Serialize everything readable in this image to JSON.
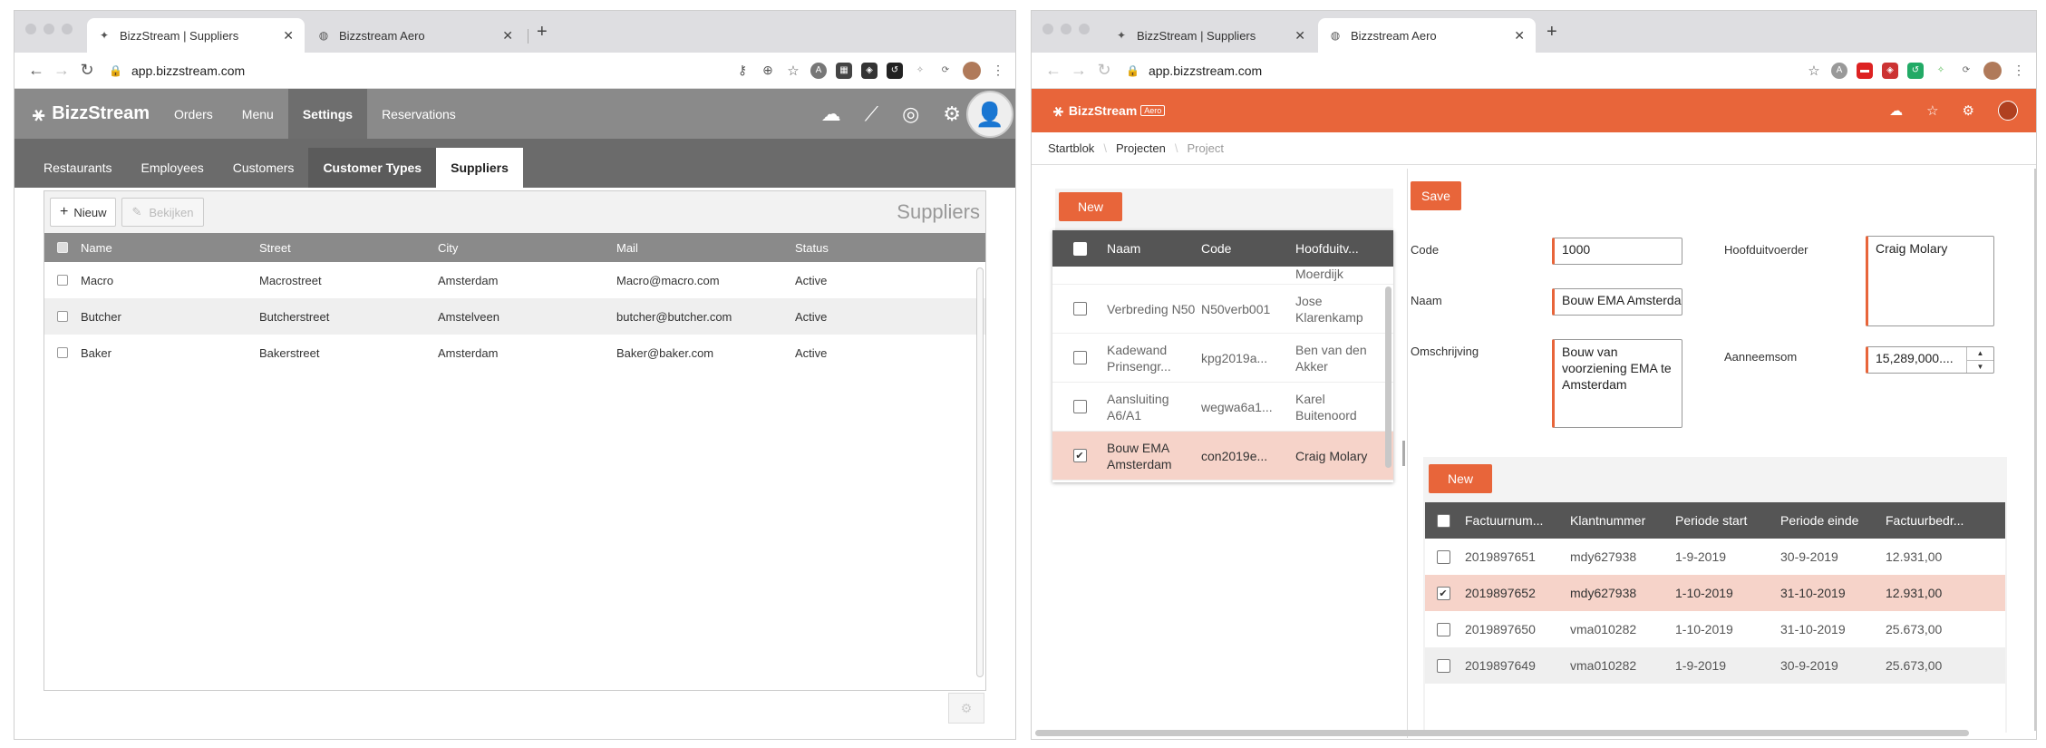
{
  "w1": {
    "browser": {
      "tabs": [
        {
          "title": "BizzStream | Suppliers"
        },
        {
          "title": "Bizzstream Aero"
        }
      ],
      "url": "app.bizzstream.com"
    },
    "app": {
      "logo": "BizzStream",
      "nav": [
        "Orders",
        "Menu",
        "Settings",
        "Reservations"
      ],
      "subtabs": [
        "Restaurants",
        "Employees",
        "Customers",
        "Customer Types",
        "Suppliers"
      ],
      "toolbar": {
        "new_label": "Nieuw",
        "view_label": "Bekijken"
      },
      "panel_title": "Suppliers",
      "columns": [
        "Name",
        "Street",
        "City",
        "Mail",
        "Status"
      ],
      "rows": [
        [
          "Macro",
          "Macrostreet",
          "Amsterdam",
          "Macro@macro.com",
          "Active"
        ],
        [
          "Butcher",
          "Butcherstreet",
          "Amstelveen",
          "butcher@butcher.com",
          "Active"
        ],
        [
          "Baker",
          "Bakerstreet",
          "Amsterdam",
          "Baker@baker.com",
          "Active"
        ]
      ]
    }
  },
  "w2": {
    "browser": {
      "tabs": [
        {
          "title": "BizzStream | Suppliers"
        },
        {
          "title": "Bizzstream Aero"
        }
      ],
      "url": "app.bizzstream.com"
    },
    "app": {
      "logo": "BizzStream",
      "logo_badge": "Aero",
      "breadcrumb": [
        "Startblok",
        "Projecten",
        "Project"
      ],
      "left": {
        "new_label": "New",
        "columns": [
          "Naam",
          "Code",
          "Hoofduitv..."
        ],
        "partial_top": "Moerdijk",
        "rows": [
          {
            "naam": "Verbreding N50",
            "code": "N50verb001",
            "hoofd": "Jose Klarenkamp",
            "checked": false
          },
          {
            "naam": "Kadewand Prinsengr...",
            "code": "kpg2019a...",
            "hoofd": "Ben van den Akker",
            "checked": false
          },
          {
            "naam": "Aansluiting A6/A1",
            "code": "wegwa6a1...",
            "hoofd": "Karel Buitenoord",
            "checked": false
          },
          {
            "naam": "Bouw EMA Amsterdam",
            "code": "con2019e...",
            "hoofd": "Craig Molary",
            "checked": true
          }
        ]
      },
      "form": {
        "save_label": "Save",
        "code_label": "Code",
        "code_value": "1000",
        "naam_label": "Naam",
        "naam_value": "Bouw EMA Amsterdam",
        "omschrijving_label": "Omschrijving",
        "omschrijving_value": "Bouw van voorziening EMA te Amsterdam",
        "hoofd_label": "Hoofduitvoerder",
        "hoofd_value": "Craig Molary",
        "aanneemsom_label": "Aanneemsom",
        "aanneemsom_value": "15,289,000...."
      },
      "invoices": {
        "new_label": "New",
        "columns": [
          "Factuurnum...",
          "Klantnummer",
          "Periode start",
          "Periode einde",
          "Factuurbedr..."
        ],
        "rows": [
          {
            "cells": [
              "2019897651",
              "mdy627938",
              "1-9-2019",
              "30-9-2019",
              "12.931,00"
            ],
            "checked": false
          },
          {
            "cells": [
              "2019897652",
              "mdy627938",
              "1-10-2019",
              "31-10-2019",
              "12.931,00"
            ],
            "checked": true
          },
          {
            "cells": [
              "2019897650",
              "vma010282",
              "1-10-2019",
              "31-10-2019",
              "25.673,00"
            ],
            "checked": false
          },
          {
            "cells": [
              "2019897649",
              "vma010282",
              "1-9-2019",
              "30-9-2019",
              "25.673,00"
            ],
            "checked": false
          }
        ]
      }
    }
  }
}
